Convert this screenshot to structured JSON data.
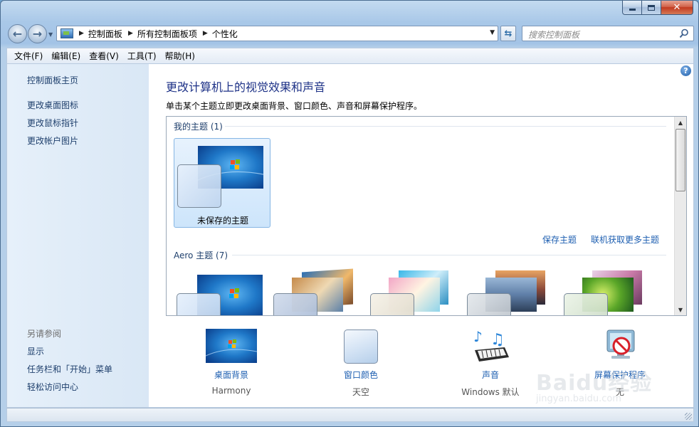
{
  "window": {
    "caption_buttons": [
      "minimize-icon",
      "maximize-icon",
      "close-icon"
    ]
  },
  "address_bar": {
    "breadcrumbs": [
      "控制面板",
      "所有控制面板项",
      "个性化"
    ]
  },
  "search": {
    "placeholder": "搜索控制面板"
  },
  "menu": [
    "文件(F)",
    "编辑(E)",
    "查看(V)",
    "工具(T)",
    "帮助(H)"
  ],
  "sidebar": {
    "home": "控制面板主页",
    "links": [
      "更改桌面图标",
      "更改鼠标指针",
      "更改帐户图片"
    ],
    "see_also_heading": "另请参阅",
    "see_also": [
      "显示",
      "任务栏和「开始」菜单",
      "轻松访问中心"
    ]
  },
  "main": {
    "title": "更改计算机上的视觉效果和声音",
    "description": "单击某个主题立即更改桌面背景、窗口颜色、声音和屏幕保护程序。",
    "my_themes": {
      "heading": "我的主题 (1)",
      "items": [
        {
          "name": "未保存的主题",
          "selected": true
        }
      ]
    },
    "save_theme": "保存主题",
    "get_more_themes": "联机获取更多主题",
    "aero_themes": {
      "heading": "Aero 主题 (7)"
    }
  },
  "settings": [
    {
      "label": "桌面背景",
      "value": "Harmony",
      "icon": "desktop-background-icon"
    },
    {
      "label": "窗口颜色",
      "value": "天空",
      "icon": "window-color-icon"
    },
    {
      "label": "声音",
      "value": "Windows 默认",
      "icon": "sounds-icon"
    },
    {
      "label": "屏幕保护程序",
      "value": "无",
      "icon": "screen-saver-icon"
    }
  ],
  "watermark": {
    "logo": "Baidu经验",
    "url": "jingyan.baidu.com"
  },
  "colors": {
    "link": "#1e5fb1",
    "title": "#1e3287",
    "sidebar_bg": "#e6f0fa",
    "selection": "#cde5fb"
  }
}
